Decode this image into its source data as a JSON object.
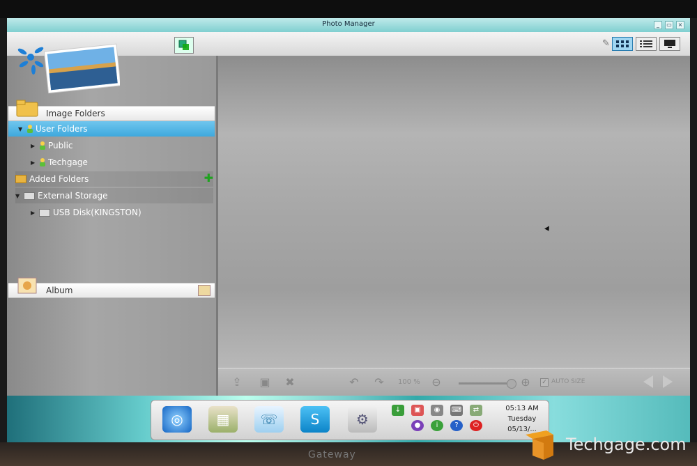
{
  "window": {
    "title": "Photo Manager"
  },
  "sidebar": {
    "image_folders_label": "Image Folders",
    "user_folders_label": "User Folders",
    "public_label": "Public",
    "techgage_label": "Techgage",
    "added_folders_label": "Added Folders",
    "external_storage_label": "External Storage",
    "usb_label": "USB Disk(KINGSTON)",
    "album_label": "Album"
  },
  "viewbar": {
    "zoom_level": "100 %",
    "auto_size_label": "AUTO SIZE"
  },
  "clock": {
    "time": "05:13 AM",
    "day": "Tuesday",
    "date": "05/13/..."
  },
  "monitor": {
    "brand": "Gateway"
  },
  "watermark": {
    "text": "Techgage.com"
  },
  "colors": {
    "accent": "#3ea8dd",
    "titlebar": "#7fcfd0",
    "dock_teal": "#66cccc"
  }
}
